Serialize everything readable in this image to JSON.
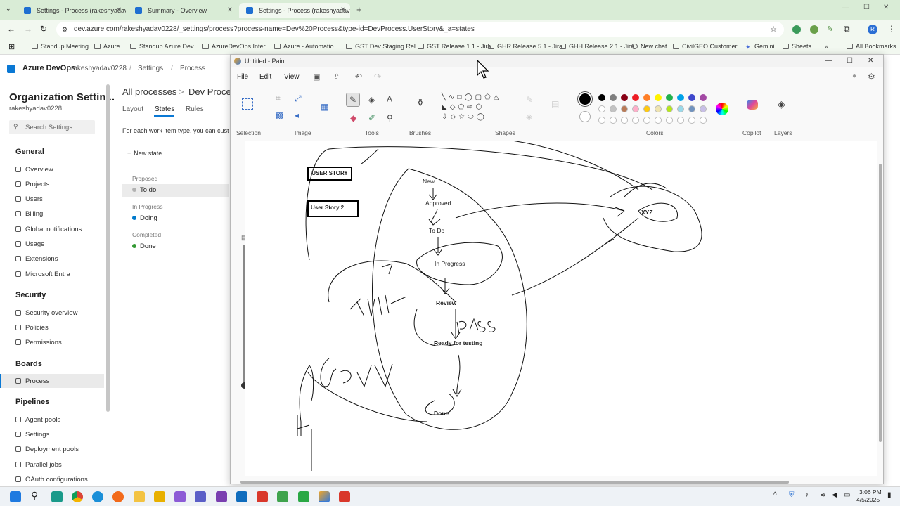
{
  "browser": {
    "tabs": [
      {
        "label": "Settings - Process (rakeshyadav",
        "active": false
      },
      {
        "label": "Summary - Overview",
        "active": false
      },
      {
        "label": "Settings - Process (rakeshyadav",
        "active": true
      }
    ],
    "url": "dev.azure.com/rakeshyadav0228/_settings/process?process-name=Dev%20Process&type-id=DevProcess.UserStory&_a=states",
    "bookmarks": [
      "Standup Meeting",
      "Azure",
      "Standup Azure Dev...",
      "AzureDevOps Inter...",
      "Azure - Automatio...",
      "GST Dev Staging Rel...",
      "GST Release 1.1 - Jira",
      "GHR Release 5.1 - Jira",
      "GHH Release 2.1 - Jira",
      "New chat",
      "CivilGEO Customer...",
      "Gemini",
      "Sheets"
    ],
    "all_bookmarks": "All Bookmarks",
    "profile_initial": "R"
  },
  "ado": {
    "brand": "Azure DevOps",
    "org": "rakeshyadav0228",
    "crumb_settings": "Settings",
    "crumb_process": "Process",
    "title": "Organization Settin...",
    "subtitle": "rakeshyadav0228",
    "search_placeholder": "Search Settings",
    "all_processes": "All processes",
    "process_crumb": "Dev Proce",
    "tabs": [
      "Layout",
      "States",
      "Rules"
    ],
    "info_text": "For each work item type, you can cust",
    "new_state": "New state",
    "states": [
      {
        "category": "Proposed",
        "name": "To do",
        "color": "#b2b2b2"
      },
      {
        "category": "In Progress",
        "name": "Doing",
        "color": "#007acc"
      },
      {
        "category": "Completed",
        "name": "Done",
        "color": "#339933"
      }
    ],
    "sections": [
      {
        "title": "General",
        "items": [
          "Overview",
          "Projects",
          "Users",
          "Billing",
          "Global notifications",
          "Usage",
          "Extensions",
          "Microsoft Entra"
        ]
      },
      {
        "title": "Security",
        "items": [
          "Security overview",
          "Policies",
          "Permissions"
        ]
      },
      {
        "title": "Boards",
        "items": [
          "Process"
        ]
      },
      {
        "title": "Pipelines",
        "items": [
          "Agent pools",
          "Settings",
          "Deployment pools",
          "Parallel jobs",
          "OAuth configurations"
        ]
      }
    ]
  },
  "paint": {
    "title": "Untitled - Paint",
    "menu": [
      "File",
      "Edit",
      "View"
    ],
    "groups": [
      "Selection",
      "Image",
      "Tools",
      "Brushes",
      "Shapes",
      "Colors",
      "Copilot",
      "Layers"
    ],
    "palette": [
      "#000000",
      "#7f7f7f",
      "#880015",
      "#ed1c24",
      "#ff7f27",
      "#fff200",
      "#22b14c",
      "#00a2e8",
      "#3f48cc",
      "#a349a4"
    ],
    "palette2": [
      "#ffffff",
      "#c3c3c3",
      "#b97a57",
      "#ffaec9",
      "#ffc90e",
      "#efe4b0",
      "#b5e61d",
      "#99d9ea",
      "#7092be",
      "#c8bfe7"
    ],
    "drawing": {
      "boxes": [
        "USER STORY",
        "User Story 2"
      ],
      "labels": [
        "New",
        "Approved",
        "To Do",
        "In Progress",
        "Review",
        "Ready for testing",
        "Done",
        "XYZ"
      ]
    }
  },
  "taskbar": {
    "time": "3:06 PM",
    "date": "4/5/2025"
  }
}
